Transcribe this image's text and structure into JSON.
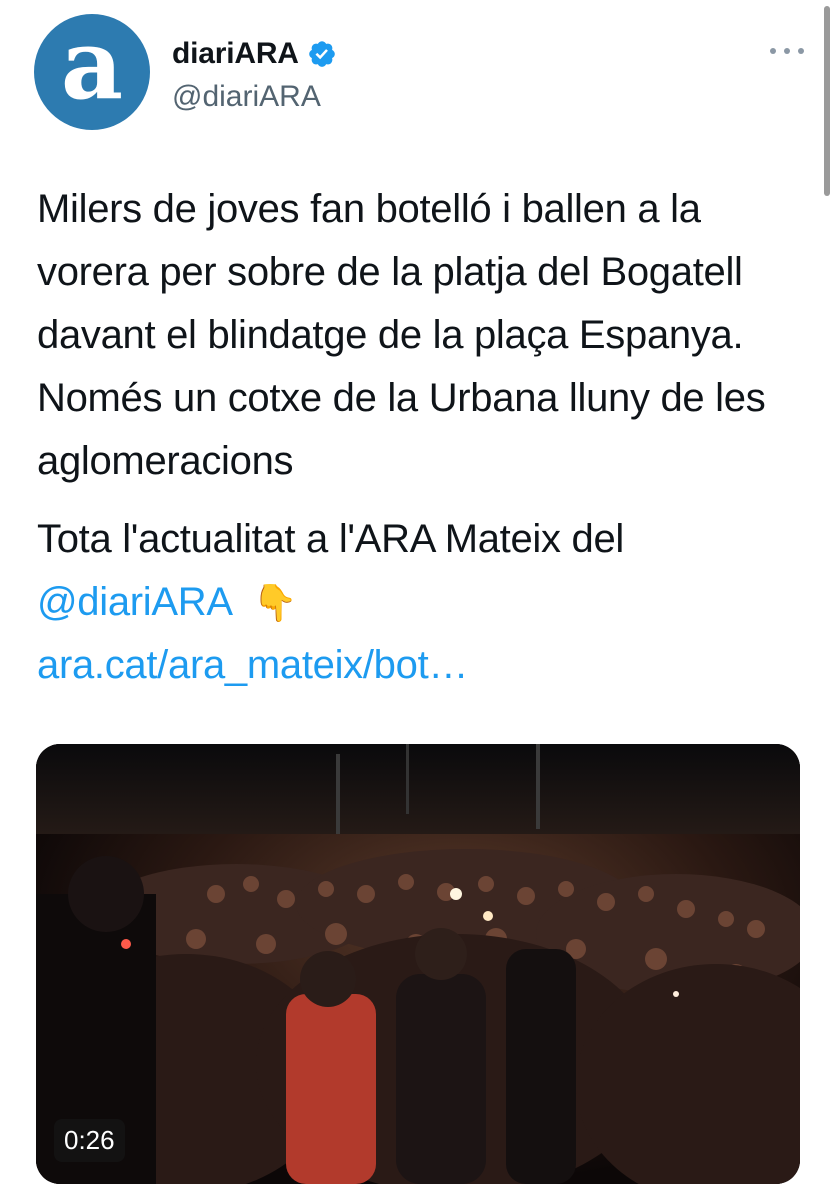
{
  "colors": {
    "accent": "#1d9bf0",
    "avatar_bg": "#2d7bb0",
    "secondary_text": "#536471"
  },
  "author": {
    "avatar_letter": "a",
    "display_name": "diariARA",
    "verified_icon": "verified-badge-icon",
    "handle": "@diariARA"
  },
  "header": {
    "more_icon": "more-options-icon"
  },
  "tweet": {
    "text": "Milers de joves fan botelló i ballen a la vorera per sobre de la platja del Bogatell davant el blindatge de la plaça Espanya. Només un cotxe de la Urbana lluny de les aglomeracions",
    "line2_prefix": "Tota l'actualitat a l'ARA Mateix del",
    "mention": "@diariARA",
    "emoji": "👇",
    "link": "ara.cat/ara_mateix/bot…"
  },
  "media": {
    "type": "video",
    "duration": "0:26"
  }
}
